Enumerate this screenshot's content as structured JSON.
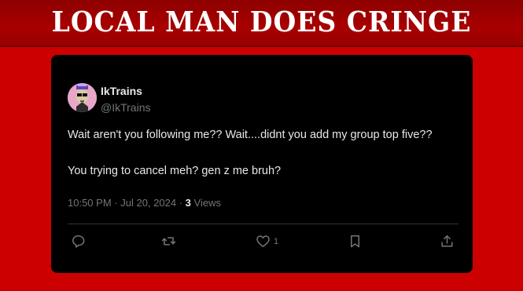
{
  "banner": {
    "title": "LOCAL MAN DOES CRINGE"
  },
  "tweet": {
    "display_name": "IkTrains",
    "handle": "@IkTrains",
    "text_line_1": "Wait aren't you following me?? Wait....didnt you add my group top five??",
    "text_line_2": "You trying to cancel meh? gen z me bruh?",
    "time": "10:50 PM",
    "date": "Jul 20, 2024",
    "views_count": "3",
    "views_label": "Views",
    "actions": {
      "reply_icon": "reply-icon",
      "retweet_icon": "retweet-icon",
      "like_icon": "heart-icon",
      "like_count": "1",
      "bookmark_icon": "bookmark-icon",
      "share_icon": "share-icon"
    }
  },
  "colors": {
    "page_background": "#cc0000",
    "banner_background": "#a80000",
    "card_background": "#000000",
    "primary_text": "#e7e9ea",
    "secondary_text": "#71767b"
  }
}
